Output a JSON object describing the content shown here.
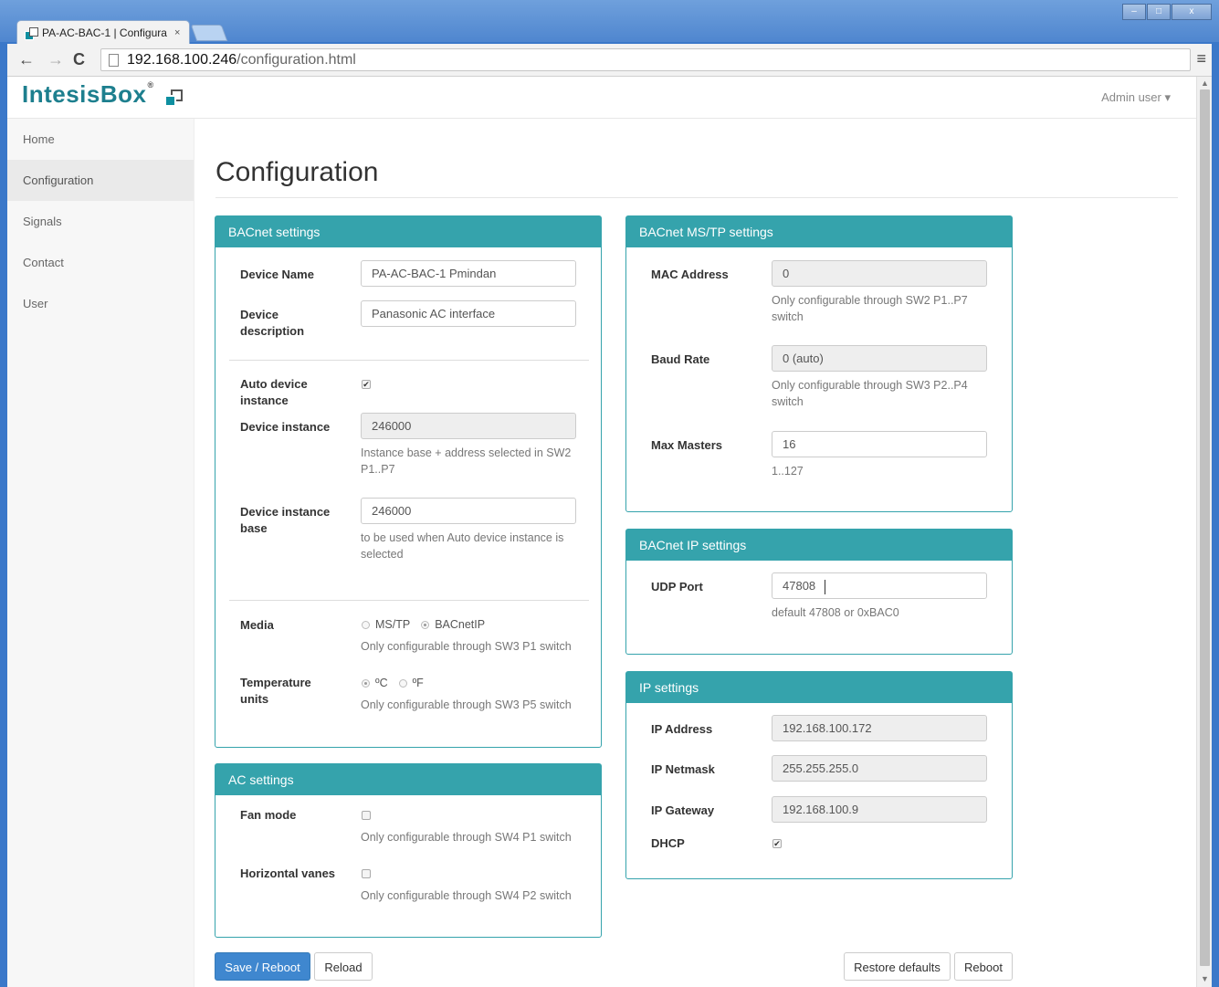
{
  "browser": {
    "tab_title": "PA-AC-BAC-1 | Configura",
    "tab_close": "×",
    "url_host": "192.168.100.246",
    "url_path": "/configuration.html",
    "window_buttons": [
      "–",
      "□",
      "x"
    ]
  },
  "header": {
    "logo_text": "IntesisBox",
    "logo_reg": "®",
    "user_menu": "Admin user ▾"
  },
  "sidebar": {
    "items": [
      {
        "label": "Home"
      },
      {
        "label": "Configuration",
        "active": true
      },
      {
        "label": "Signals"
      },
      {
        "label": "Contact"
      },
      {
        "label": "User"
      }
    ]
  },
  "page": {
    "title": "Configuration"
  },
  "bacnet": {
    "heading": "BACnet settings",
    "device_name_label": "Device Name",
    "device_name_value": "PA-AC-BAC-1  Pmindan",
    "device_desc_label": "Device description",
    "device_desc_value": "Panasonic AC interface",
    "auto_instance_label": "Auto device instance",
    "auto_instance_checked": true,
    "instance_label": "Device instance",
    "instance_value": "246000",
    "instance_help": "Instance base + address selected in SW2 P1..P7",
    "instance_base_label": "Device instance base",
    "instance_base_value": "246000",
    "instance_base_help": "to be used when Auto device instance is selected",
    "media_label": "Media",
    "media_opt1": "MS/TP",
    "media_opt2": "BACnetIP",
    "media_selected": "BACnetIP",
    "media_help": "Only configurable through SW3 P1 switch",
    "temp_label": "Temperature units",
    "temp_opt1": "ºC",
    "temp_opt2": "ºF",
    "temp_selected": "ºC",
    "temp_help": "Only configurable through SW3 P5 switch"
  },
  "ac": {
    "heading": "AC settings",
    "fan_label": "Fan mode",
    "fan_checked": false,
    "fan_help": "Only configurable through SW4 P1 switch",
    "vanes_label": "Horizontal vanes",
    "vanes_checked": false,
    "vanes_help": "Only configurable through SW4 P2 switch"
  },
  "mstp": {
    "heading": "BACnet MS/TP settings",
    "mac_label": "MAC Address",
    "mac_value": "0",
    "mac_help": "Only configurable through SW2 P1..P7 switch",
    "baud_label": "Baud Rate",
    "baud_value": "0 (auto)",
    "baud_help": "Only configurable through SW3 P2..P4 switch",
    "masters_label": "Max Masters",
    "masters_value": "16",
    "masters_help": "1..127"
  },
  "bip": {
    "heading": "BACnet IP settings",
    "udp_label": "UDP Port",
    "udp_value": "47808",
    "udp_help": "default 47808 or 0xBAC0"
  },
  "ip": {
    "heading": "IP settings",
    "addr_label": "IP Address",
    "addr_value": "192.168.100.172",
    "mask_label": "IP Netmask",
    "mask_value": "255.255.255.0",
    "gw_label": "IP Gateway",
    "gw_value": "192.168.100.9",
    "dhcp_label": "DHCP",
    "dhcp_checked": true
  },
  "actions": {
    "save": "Save / Reboot",
    "reload": "Reload",
    "restore": "Restore defaults",
    "reboot": "Reboot"
  },
  "colors": {
    "accent": "#35a3ac",
    "primary_button": "#3f87cf",
    "logo": "#1d7f8e"
  }
}
